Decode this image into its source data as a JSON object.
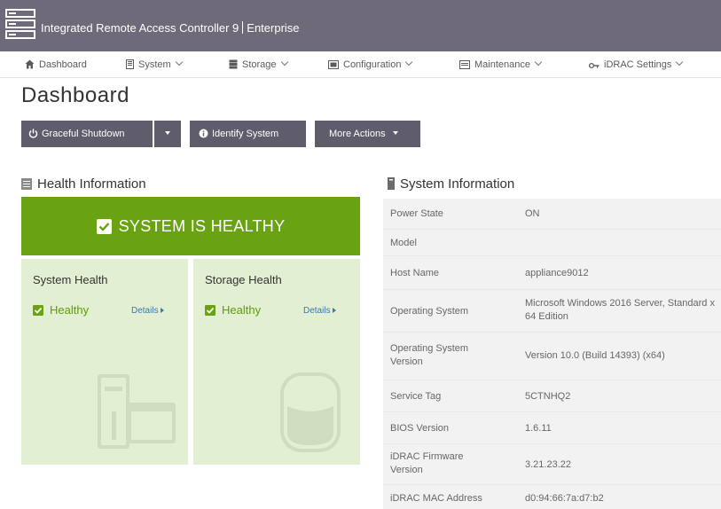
{
  "app": {
    "title": "Integrated Remote Access Controller 9",
    "edition": "Enterprise",
    "logo_icon": "server-rack-icon"
  },
  "nav": {
    "items": [
      {
        "label": "Dashboard",
        "icon": "home-icon",
        "dropdown": false
      },
      {
        "label": "System",
        "icon": "system-icon",
        "dropdown": true
      },
      {
        "label": "Storage",
        "icon": "storage-icon",
        "dropdown": true
      },
      {
        "label": "Configuration",
        "icon": "configuration-icon",
        "dropdown": true
      },
      {
        "label": "Maintenance",
        "icon": "maintenance-icon",
        "dropdown": true
      },
      {
        "label": "iDRAC Settings",
        "icon": "key-icon",
        "dropdown": true
      }
    ]
  },
  "page": {
    "title": "Dashboard"
  },
  "toolbar": {
    "graceful_shutdown": "Graceful Shutdown",
    "identify_system": "Identify System",
    "more_actions": "More Actions"
  },
  "health": {
    "heading": "Health Information",
    "banner": "SYSTEM IS HEALTHY",
    "cards": [
      {
        "title": "System Health",
        "status": "Healthy",
        "details": "Details"
      },
      {
        "title": "Storage Health",
        "status": "Healthy",
        "details": "Details"
      }
    ]
  },
  "system_info": {
    "heading": "System Information",
    "rows": [
      {
        "label": "Power State",
        "value": "ON"
      },
      {
        "label": "Model",
        "value": ""
      },
      {
        "label": "Host Name",
        "value": "appliance9012"
      },
      {
        "label": "Operating System",
        "value": "Microsoft Windows 2016 Server, Standard x64 Edition"
      },
      {
        "label": "Operating System Version",
        "value": "Version 10.0 (Build 14393) (x64)"
      },
      {
        "label": "Service Tag",
        "value": "5CTNHQ2"
      },
      {
        "label": "BIOS Version",
        "value": "1.6.11"
      },
      {
        "label": "iDRAC Firmware Version",
        "value": "3.21.23.22"
      },
      {
        "label": "iDRAC MAC Address",
        "value": "d0:94:66:7a:d7:b2"
      }
    ]
  },
  "colors": {
    "titlebar": "#6e6a7a",
    "button": "#5f5c6b",
    "healthy_green": "#6aa312",
    "card_bg": "#e3efd2",
    "link": "#3a7aa4"
  }
}
